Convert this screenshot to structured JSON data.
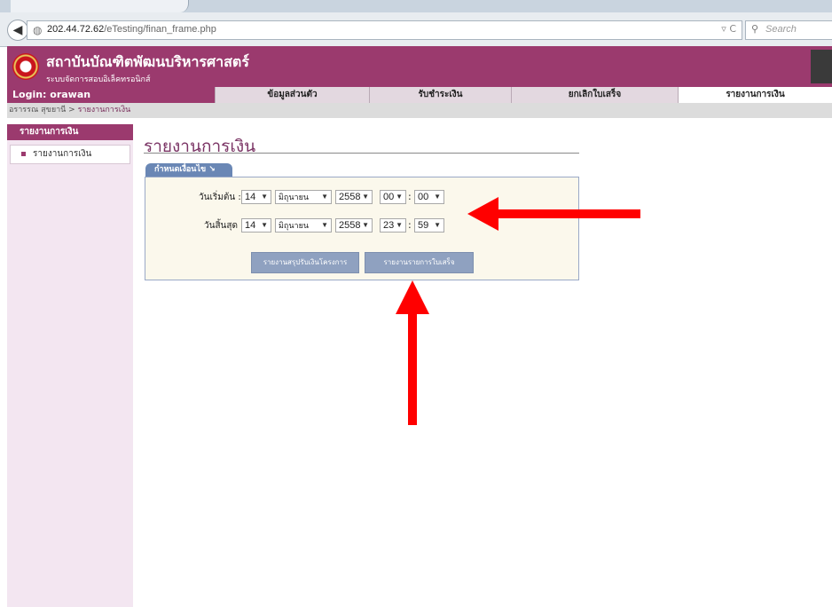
{
  "browser": {
    "url_host": "202.44.72.62",
    "url_path": "/eTesting/finan_frame.php",
    "search_placeholder": "Search"
  },
  "site": {
    "title": "สถาบันบัณฑิตพัฒนบริหารศาสตร์",
    "subtitle": "ระบบจัดการสอบอิเล็คทรอนิกส์"
  },
  "menu": {
    "login": "Login: orawan",
    "items": [
      "ข้อมูลส่วนตัว",
      "รับชำระเงิน",
      "ยกเลิกใบเสร็จ",
      "รายงานการเงิน"
    ]
  },
  "breadcrumb": {
    "user": "อรารรณ สุขยานี",
    "sep": ">",
    "current": "รายงานการเงิน"
  },
  "sidebar": {
    "heading": "รายงานการเงิน",
    "item": "รายงานการเงิน"
  },
  "main": {
    "title": "รายงานการเงิน",
    "panel_tab": "กำหนดเงื่อนไข ↘",
    "start_label": "วันเริ่มต้น :",
    "end_label": "วันสิ้นสุด :",
    "start": {
      "day": "14",
      "month": "มิถุนายน",
      "year": "2558",
      "hour": "00",
      "minute": "00"
    },
    "end": {
      "day": "14",
      "month": "มิถุนายน",
      "year": "2558",
      "hour": "23",
      "minute": "59"
    },
    "btn_summary": "รายงานสรุปรับเงินโครงการ",
    "btn_receipts": "รายงานรายการใบเสร็จ"
  },
  "colors": {
    "brand": "#9b3a6e",
    "panel_accent": "#6a87b5",
    "annotation": "#ff0000"
  }
}
